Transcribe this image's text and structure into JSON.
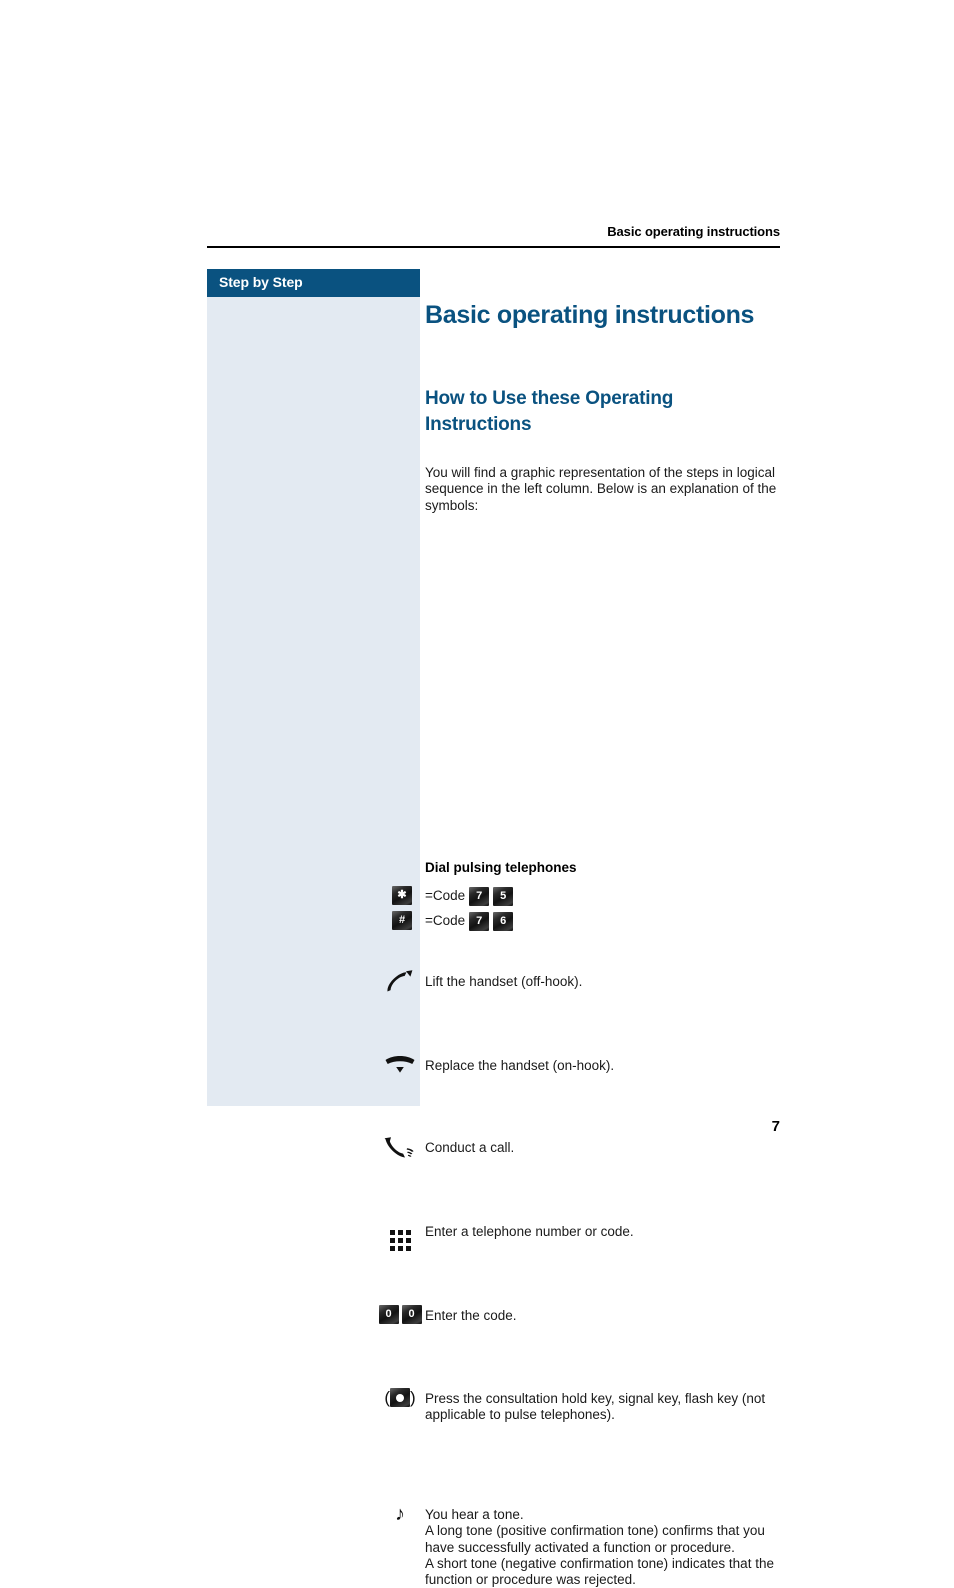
{
  "header": {
    "running_title": "Basic operating instructions"
  },
  "sidebar": {
    "title": "Step by Step",
    "header_bg": "#0a5280",
    "body_bg": "#e3eaf2"
  },
  "content": {
    "title": "Basic operating instructions",
    "subtitle": "How to Use these Operating Instructions",
    "intro": "You will find a graphic representation of the steps in logical sequence in the left column. Below is an explanation of the symbols:",
    "accent_color": "#0a5280",
    "symbols": [
      {
        "icon": "handset-lifted-icon",
        "text": "Lift the handset (off-hook)."
      },
      {
        "icon": "handset-replaced-icon",
        "text": "Replace the handset (on-hook)."
      },
      {
        "icon": "handset-conversation-icon",
        "text": "Conduct a call."
      },
      {
        "icon": "dial-keypad-icon",
        "text": "Enter a telephone number or code."
      },
      {
        "icon": "zero-zero-keys-icon",
        "keys": [
          "0",
          "0"
        ],
        "text": "Enter the code."
      },
      {
        "icon": "consultation-hold-key-icon",
        "text": "Press the consultation hold key, signal key, flash key (not applicable to pulse telephones)."
      },
      {
        "icon": "music-note-icon",
        "glyph": "♪",
        "text": "You hear a tone.\nA long tone (positive confirmation tone) confirms that you have successfully activated a function or procedure.\nA short tone (negative confirmation tone) indicates that the function or procedure was rejected."
      }
    ],
    "dial_pulsing": {
      "heading": "Dial pulsing telephones",
      "rows": [
        {
          "key": "✱",
          "key_name": "star-key",
          "label": "=Code",
          "codes": [
            "7",
            "5"
          ]
        },
        {
          "key": "#",
          "key_name": "hash-key",
          "label": "=Code",
          "codes": [
            "7",
            "6"
          ]
        }
      ]
    }
  },
  "footer": {
    "page_number": "7"
  }
}
